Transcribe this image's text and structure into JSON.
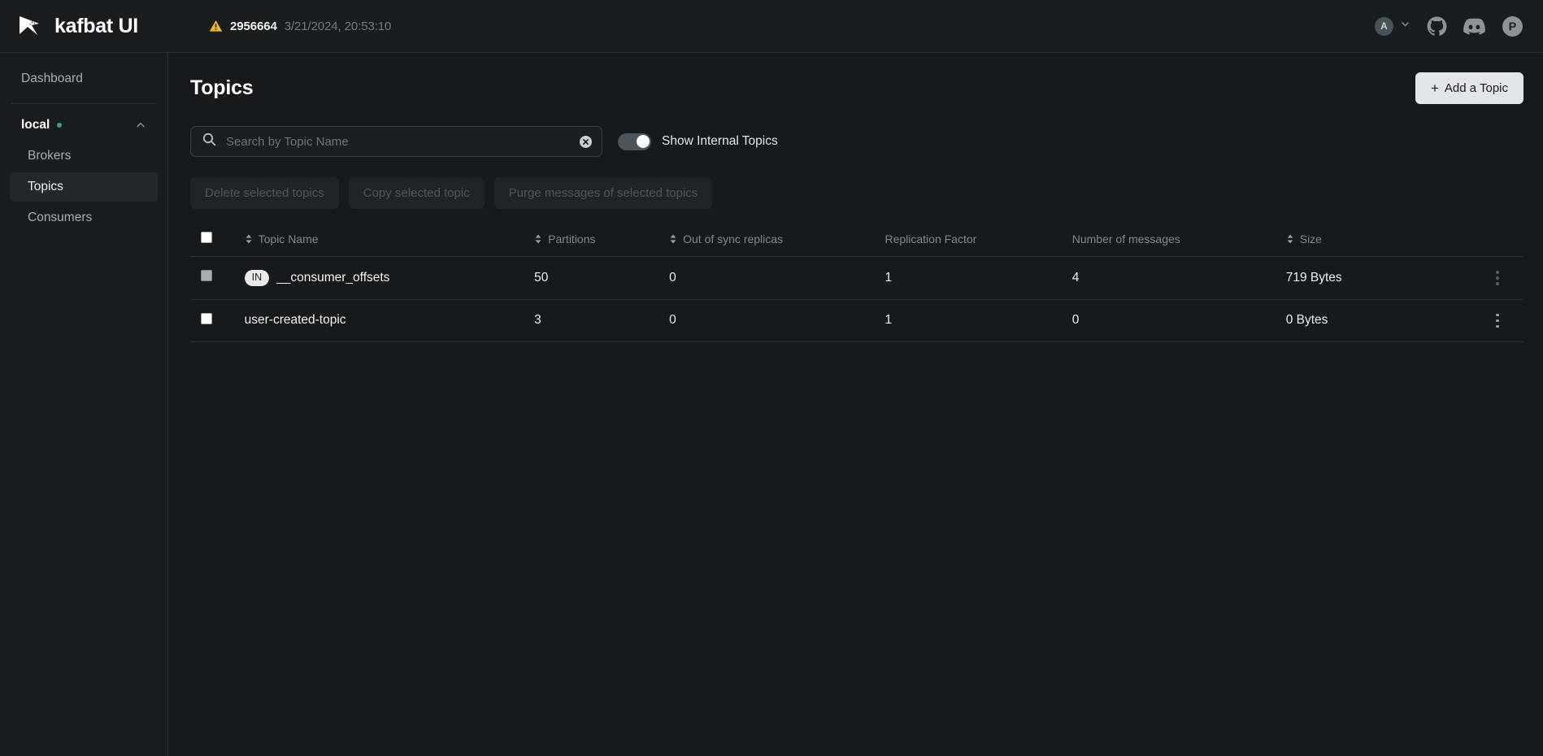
{
  "topbar": {
    "brand_title": "kafbat UI",
    "logo_icon": "kafbat-arrow-logo",
    "warning_icon": "warning-triangle-icon",
    "commit_id": "2956664",
    "commit_date": "3/21/2024, 20:53:10",
    "user_initial": "A",
    "user_chevron_icon": "chevron-down-icon",
    "github_icon": "github-icon",
    "discord_icon": "discord-icon",
    "product_icon": "p-circle-icon"
  },
  "sidebar": {
    "dashboard_label": "Dashboard",
    "cluster": {
      "name": "local",
      "status_dot_color": "#3ea570",
      "collapse_icon": "chevron-up-icon"
    },
    "items": [
      {
        "label": "Brokers",
        "active": false
      },
      {
        "label": "Topics",
        "active": true
      },
      {
        "label": "Consumers",
        "active": false
      }
    ]
  },
  "main": {
    "page_title": "Topics",
    "add_topic_label": "Add a Topic",
    "add_topic_plus": "+",
    "search": {
      "placeholder": "Search by Topic Name",
      "value": "",
      "search_icon": "search-icon",
      "clear_icon": "clear-circle-icon"
    },
    "internal_toggle": {
      "label": "Show Internal Topics",
      "enabled": true
    },
    "actions": [
      {
        "label": "Delete selected topics",
        "disabled": true
      },
      {
        "label": "Copy selected topic",
        "disabled": true
      },
      {
        "label": "Purge messages of selected topics",
        "disabled": true
      }
    ],
    "table": {
      "headers": [
        {
          "label": "Topic Name",
          "sortable": true
        },
        {
          "label": "Partitions",
          "sortable": true
        },
        {
          "label": "Out of sync replicas",
          "sortable": true
        },
        {
          "label": "Replication Factor",
          "sortable": false
        },
        {
          "label": "Number of messages",
          "sortable": false
        },
        {
          "label": "Size",
          "sortable": true
        }
      ],
      "rows": [
        {
          "checkbox_state": "disabled",
          "badge": "IN",
          "name": "__consumer_offsets",
          "partitions": "50",
          "out_of_sync_replicas": "0",
          "replication_factor": "1",
          "number_of_messages": "4",
          "size": "719 Bytes",
          "menu_icon": "kebab-menu-icon"
        },
        {
          "checkbox_state": "unchecked",
          "badge": "",
          "name": "user-created-topic",
          "partitions": "3",
          "out_of_sync_replicas": "0",
          "replication_factor": "1",
          "number_of_messages": "0",
          "size": "0 Bytes",
          "menu_icon": "kebab-menu-icon"
        }
      ]
    }
  },
  "colors": {
    "app_background": "#171a1c",
    "panel_background": "#1a1d1f",
    "border": "#2b3033",
    "accent_button": "#e3e6e8",
    "warning": "#f0b429",
    "online_dot": "#3ea570",
    "muted_text": "#81878c"
  }
}
